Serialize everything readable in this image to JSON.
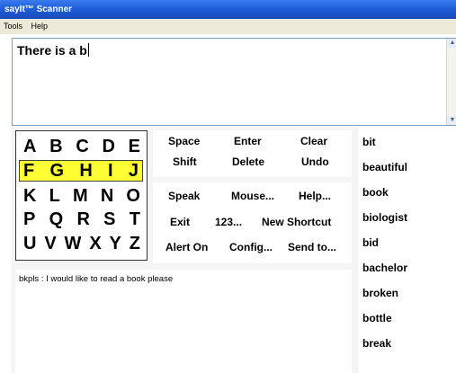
{
  "window": {
    "title": "sayIt™ Scanner"
  },
  "menu": [
    "Tools",
    "Help"
  ],
  "editor": {
    "text": "There is a b"
  },
  "scrollbar": {
    "up": "▲",
    "down": "▼"
  },
  "letter_rows": [
    [
      "A",
      "B",
      "C",
      "D",
      "E"
    ],
    [
      "F",
      "G",
      "H",
      "I",
      "J"
    ],
    [
      "K",
      "L",
      "M",
      "N",
      "O"
    ],
    [
      "P",
      "Q",
      "R",
      "S",
      "T"
    ],
    [
      "U",
      "V",
      "W",
      "X",
      "Y",
      "Z"
    ]
  ],
  "highlighted_row": 1,
  "commands_top": [
    "Space",
    "Enter",
    "Clear",
    "Shift",
    "Delete",
    "Undo"
  ],
  "commands_bottom": [
    "Speak",
    "Mouse...",
    "Help...",
    "Exit",
    "123...",
    "New Shortcut",
    "Alert On",
    "Config...",
    "Send to..."
  ],
  "message": "bkpls : I would like to read a book please",
  "predictions": [
    "bit",
    "beautiful",
    "book",
    "biologist",
    "bid",
    "bachelor",
    "broken",
    "bottle",
    "break"
  ]
}
